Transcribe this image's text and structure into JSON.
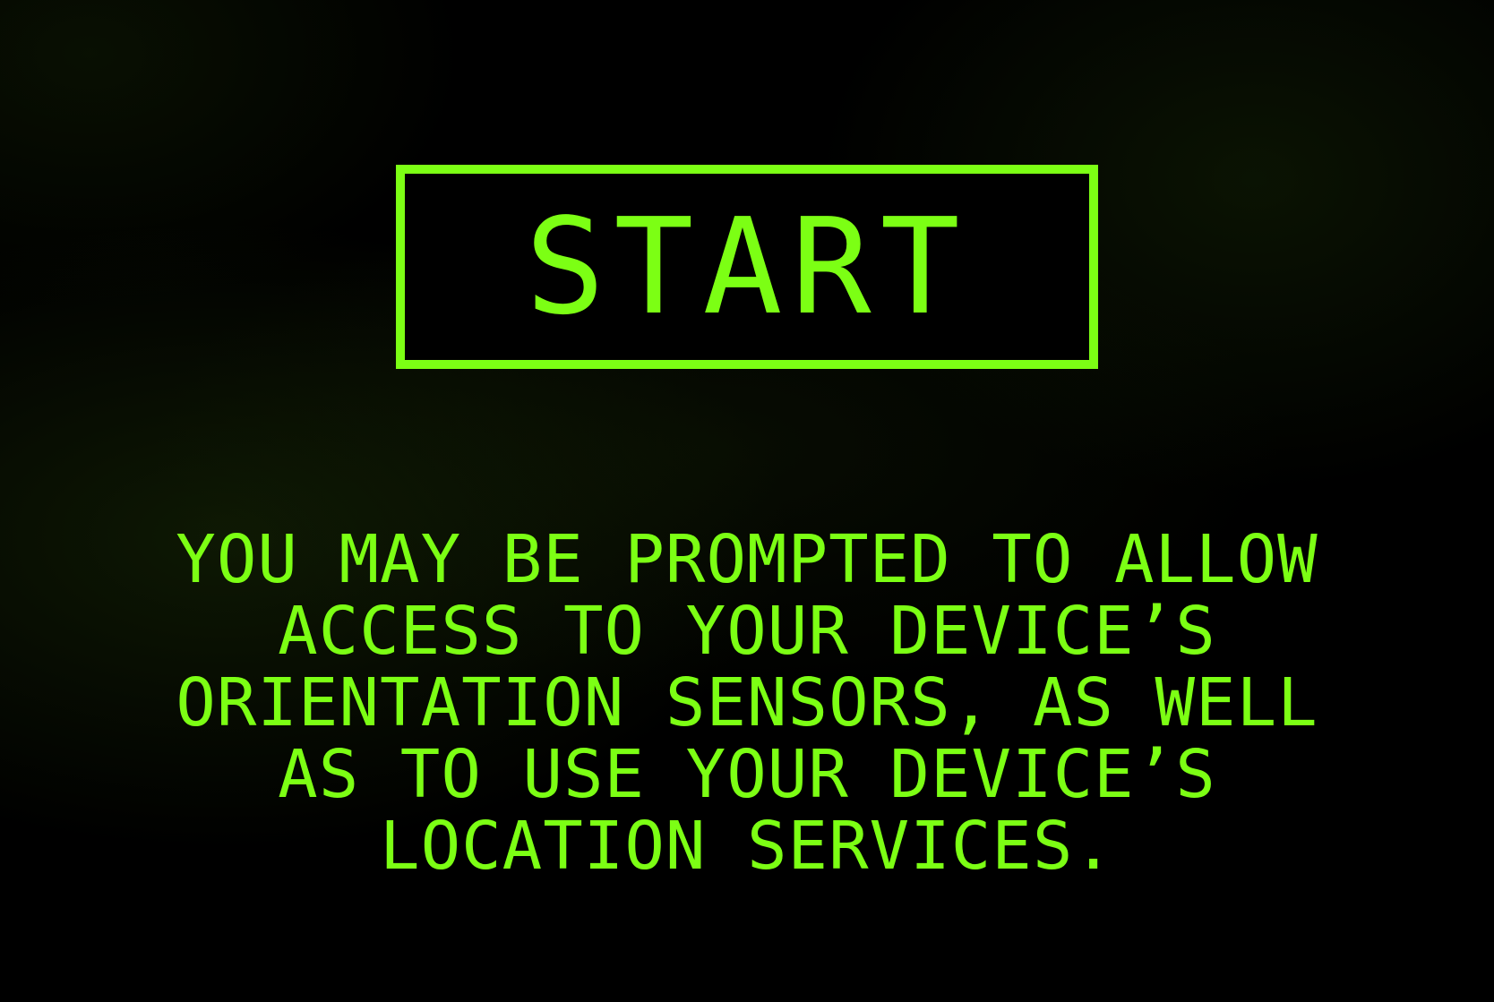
{
  "start_button": {
    "label": "START"
  },
  "notice": {
    "lines": [
      "YOU MAY BE PROMPTED TO ALLOW",
      "ACCESS TO YOUR DEVICE’S",
      "ORIENTATION SENSORS, AS WELL",
      "AS TO USE YOUR DEVICE’S",
      "LOCATION SERVICES."
    ]
  },
  "colors": {
    "accent": "#7cff14",
    "background": "#000000"
  }
}
